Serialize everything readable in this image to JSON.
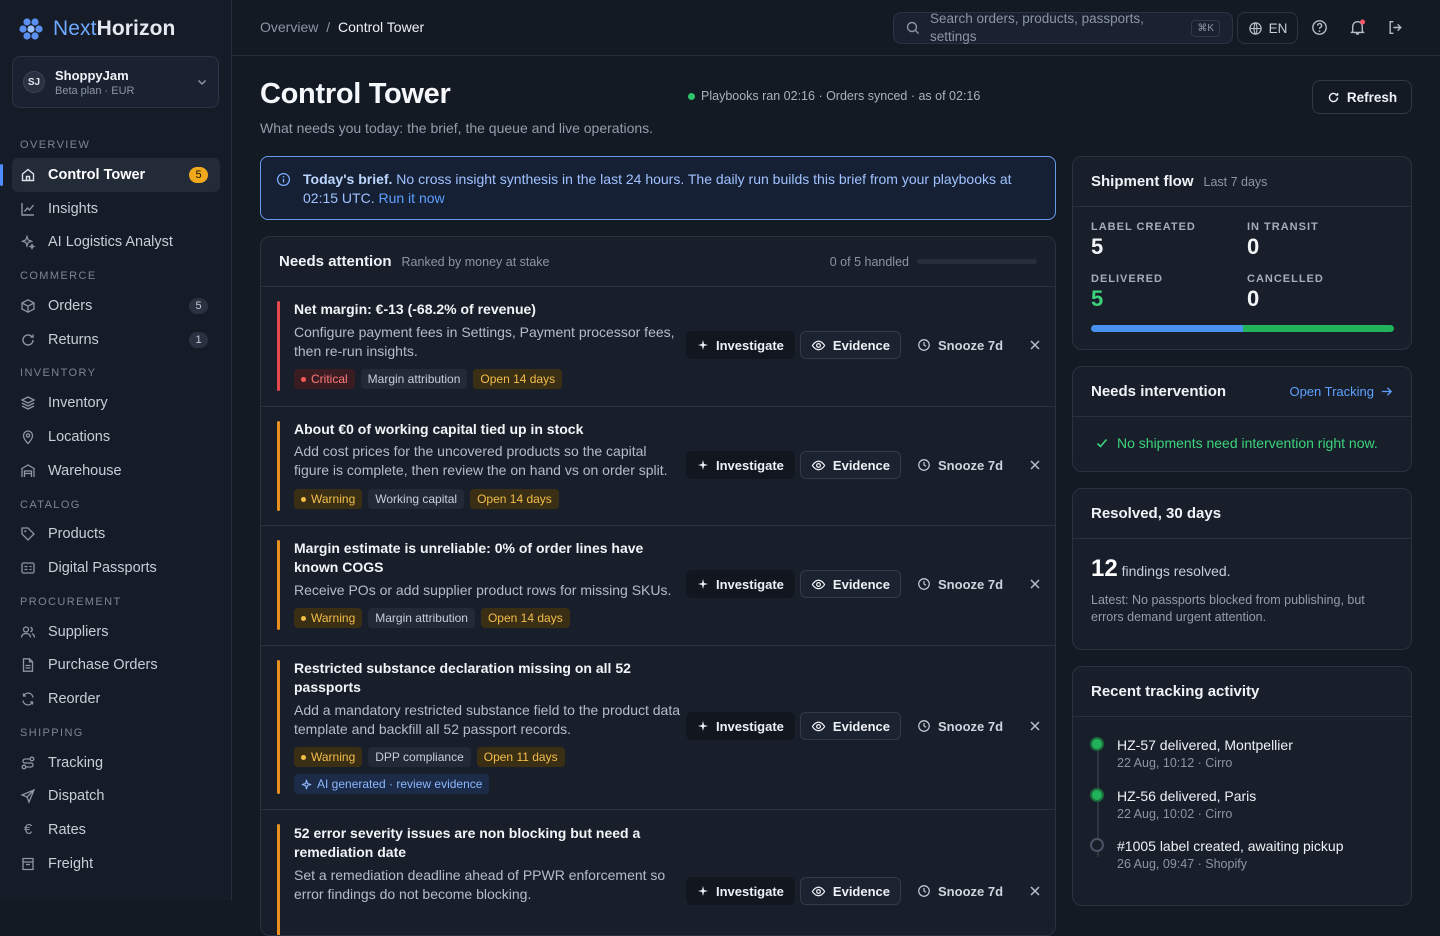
{
  "app": {
    "brand_a": "Next",
    "brand_b": "Horizon",
    "workspace_initials": "SJ",
    "workspace_name": "ShoppyJam",
    "workspace_plan": "Beta plan · EUR"
  },
  "nav": {
    "overview_label": "OVERVIEW",
    "commerce_label": "COMMERCE",
    "inventory_label": "INVENTORY",
    "catalog_label": "CATALOG",
    "procurement_label": "PROCUREMENT",
    "shipping_label": "SHIPPING",
    "control_tower": "Control Tower",
    "control_tower_count": "5",
    "insights": "Insights",
    "ai_analyst": "AI Logistics Analyst",
    "orders": "Orders",
    "orders_count": "5",
    "returns": "Returns",
    "returns_count": "1",
    "inventory": "Inventory",
    "locations": "Locations",
    "warehouse": "Warehouse",
    "products": "Products",
    "digital_passports": "Digital Passports",
    "suppliers": "Suppliers",
    "purchase_orders": "Purchase Orders",
    "reorder": "Reorder",
    "tracking": "Tracking",
    "dispatch": "Dispatch",
    "rates": "Rates",
    "freight": "Freight"
  },
  "topbar": {
    "crumb_parent": "Overview",
    "crumb_sep": "/",
    "crumb_current": "Control Tower",
    "search_placeholder": "Search orders, products, passports, settings",
    "search_shortcut": "⌘K",
    "lang": "EN"
  },
  "header": {
    "title": "Control Tower",
    "subtitle": "What needs you today: the brief, the queue and live operations.",
    "status": "Playbooks ran 02:16 · Orders synced · as of 02:16",
    "refresh": "Refresh"
  },
  "brief": {
    "lead": "Today's brief.",
    "text": " No cross insight synthesis in the last 24 hours. The daily run builds this brief from your playbooks at 02:15 UTC. ",
    "link": "Run it now"
  },
  "attention": {
    "title": "Needs attention",
    "subtitle": "Ranked by money at stake",
    "handled": "0 of 5 handled",
    "handled_fraction": 0,
    "actions": {
      "investigate": "Investigate",
      "evidence": "Evidence",
      "snooze": "Snooze 7d"
    },
    "items": [
      {
        "title": "Net margin: €-13 (-68.2% of revenue)",
        "desc": "Configure payment fees in Settings, Payment processor fees, then re-run insights.",
        "severity": "Critical",
        "category": "Margin attribution",
        "age": "Open 14 days"
      },
      {
        "title": "About €0 of working capital tied up in stock",
        "desc": "Add cost prices for the uncovered products so the capital figure is complete, then review the on hand vs on order split.",
        "severity": "Warning",
        "category": "Working capital",
        "age": "Open 14 days"
      },
      {
        "title": "Margin estimate is unreliable: 0% of order lines have known COGS",
        "desc": "Receive POs or add supplier product rows for missing SKUs.",
        "severity": "Warning",
        "category": "Margin attribution",
        "age": "Open 14 days"
      },
      {
        "title": "Restricted substance declaration missing on all 52 passports",
        "desc": "Add a mandatory restricted substance field to the product data template and backfill all 52 passport records.",
        "severity": "Warning",
        "category": "DPP compliance",
        "age": "Open 11 days",
        "ai": "AI generated · review evidence"
      },
      {
        "title": "52 error severity issues are non blocking but need a remediation date",
        "desc": "Set a remediation deadline ahead of PPWR enforcement so error findings do not become blocking."
      }
    ]
  },
  "flow": {
    "title": "Shipment flow",
    "period": "Last 7 days",
    "label_created_l": "LABEL CREATED",
    "label_created": "5",
    "in_transit_l": "IN TRANSIT",
    "in_transit": "0",
    "delivered_l": "DELIVERED",
    "delivered": "5",
    "cancelled_l": "CANCELLED",
    "cancelled": "0",
    "colors": {
      "label_created": "#4a90f0",
      "delivered": "#21b35a"
    }
  },
  "intervention": {
    "title": "Needs intervention",
    "link": "Open Tracking",
    "empty": "No shipments need intervention right now."
  },
  "resolved": {
    "title": "Resolved, 30 days",
    "count": "12",
    "unit": "findings resolved.",
    "latest": "Latest: No passports blocked from publishing, but errors demand urgent attention."
  },
  "activity": {
    "title": "Recent tracking activity",
    "events": [
      {
        "title": "HZ-57 delivered, Montpellier",
        "meta": "22 Aug, 10:12 · Cirro",
        "state": "done"
      },
      {
        "title": "HZ-56 delivered, Paris",
        "meta": "22 Aug, 10:02 · Cirro",
        "state": "done"
      },
      {
        "title": "#1005 label created, awaiting pickup",
        "meta": "26 Aug, 09:47 · Shopify",
        "state": "pending"
      }
    ]
  }
}
